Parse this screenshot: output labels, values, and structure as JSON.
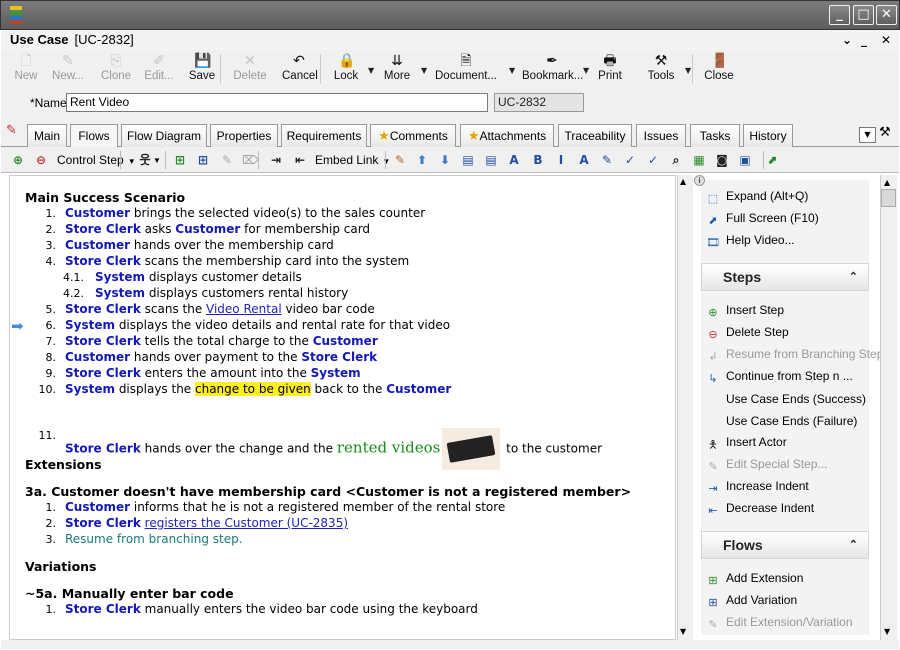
{
  "window": {
    "minimize": "_",
    "maximize": "□",
    "close": "✕"
  },
  "doc": {
    "type": "Use Case",
    "id_bracket": "[UC-2832]",
    "pin": "⌄",
    "close": "✕"
  },
  "toolbar": [
    {
      "label": "New",
      "icon": "new-document-icon",
      "glyph": "🗋",
      "enabled": false
    },
    {
      "label": "New...",
      "icon": "new-wizard-icon",
      "glyph": "✎",
      "enabled": false
    },
    {
      "label": "Clone",
      "icon": "clone-icon",
      "glyph": "⎘",
      "enabled": false
    },
    {
      "label": "Edit...",
      "icon": "edit-icon",
      "glyph": "✐",
      "enabled": false
    },
    {
      "label": "Save",
      "icon": "save-icon",
      "glyph": "💾",
      "enabled": true
    },
    {
      "label": "Delete",
      "icon": "delete-icon",
      "glyph": "✕",
      "enabled": false
    },
    {
      "label": "Cancel",
      "icon": "cancel-icon",
      "glyph": "↶",
      "enabled": true
    },
    {
      "label": "Lock",
      "icon": "lock-icon",
      "glyph": "🔒",
      "enabled": true
    },
    {
      "label": "More",
      "icon": "more-icon",
      "glyph": "⇊",
      "enabled": true
    },
    {
      "label": "Document...",
      "icon": "document-icon",
      "glyph": "🗎",
      "enabled": true
    },
    {
      "label": "Bookmark...",
      "icon": "bookmark-icon",
      "glyph": "✒",
      "enabled": true
    },
    {
      "label": "Print",
      "icon": "print-icon",
      "glyph": "🖶",
      "enabled": true
    },
    {
      "label": "Tools",
      "icon": "tools-icon",
      "glyph": "⚒",
      "enabled": true
    },
    {
      "label": "Close",
      "icon": "close-door-icon",
      "glyph": "🚪",
      "enabled": true
    }
  ],
  "name_field": {
    "label": "*Name:",
    "value": "Rent Video",
    "id_value": "UC-2832"
  },
  "tabs": [
    "Main",
    "Flows",
    "Flow Diagram",
    "Properties",
    "Requirements",
    "Comments",
    "Attachments",
    "Traceability",
    "Issues",
    "Tasks",
    "History"
  ],
  "active_tab": "Flows",
  "toolbar2": {
    "control_step": "Control Step",
    "embed_link": "Embed Link"
  },
  "scenario": {
    "main_heading": "Main Success Scenario",
    "steps": [
      {
        "n": "1.",
        "parts": [
          [
            "a",
            "Customer"
          ],
          [
            "t",
            " brings the selected video(s) to the sales counter"
          ]
        ]
      },
      {
        "n": "2.",
        "parts": [
          [
            "a",
            "Store Clerk"
          ],
          [
            "t",
            " asks "
          ],
          [
            "a",
            "Customer"
          ],
          [
            "t",
            " for membership card"
          ]
        ]
      },
      {
        "n": "3.",
        "parts": [
          [
            "a",
            "Customer"
          ],
          [
            "t",
            " hands over the membership card"
          ]
        ]
      },
      {
        "n": "4.",
        "parts": [
          [
            "a",
            "Store Clerk"
          ],
          [
            "t",
            " scans the membership card into the system"
          ]
        ]
      },
      {
        "n": "4.1.",
        "sub": true,
        "parts": [
          [
            "a",
            "System"
          ],
          [
            "t",
            " displays customer details"
          ]
        ]
      },
      {
        "n": "4.2.",
        "sub": true,
        "parts": [
          [
            "a",
            "System"
          ],
          [
            "t",
            " displays customers rental history"
          ]
        ]
      },
      {
        "n": "5.",
        "parts": [
          [
            "a",
            "Store Clerk"
          ],
          [
            "t",
            " scans the "
          ],
          [
            "l",
            "Video Rental"
          ],
          [
            "t",
            " video bar code"
          ]
        ]
      },
      {
        "n": "6.",
        "parts": [
          [
            "a",
            "System"
          ],
          [
            "t",
            " displays the video details and rental rate for that video"
          ]
        ]
      },
      {
        "n": "7.",
        "parts": [
          [
            "a",
            "Store Clerk"
          ],
          [
            "t",
            " tells the total charge to the "
          ],
          [
            "a",
            "Customer"
          ]
        ]
      },
      {
        "n": "8.",
        "parts": [
          [
            "a",
            "Customer"
          ],
          [
            "t",
            " hands over payment to the "
          ],
          [
            "a",
            "Store Clerk"
          ]
        ]
      },
      {
        "n": "9.",
        "parts": [
          [
            "a",
            "Store Clerk"
          ],
          [
            "t",
            " enters the amount into the "
          ],
          [
            "a",
            "System"
          ]
        ]
      },
      {
        "n": "10.",
        "parts": [
          [
            "a",
            "System"
          ],
          [
            "t",
            " displays the "
          ],
          [
            "h",
            "change to be given"
          ],
          [
            "t",
            " back to the "
          ],
          [
            "a",
            "Customer"
          ]
        ]
      },
      {
        "n": "11.",
        "parts": [
          [
            "a",
            "Store Clerk"
          ],
          [
            "t",
            " hands over the change and the "
          ],
          [
            "g",
            "rented videos"
          ],
          [
            "img",
            ""
          ],
          [
            "t",
            " to the customer"
          ]
        ]
      }
    ],
    "ext_heading": "Extensions",
    "ext_title": "3a. Customer doesn't have membership card <Customer is not a registered member>",
    "ext_steps": [
      {
        "n": "1.",
        "parts": [
          [
            "a",
            "Customer"
          ],
          [
            "t",
            " informs that he is not a registered member of the rental store"
          ]
        ]
      },
      {
        "n": "2.",
        "parts": [
          [
            "a",
            "Store Clerk"
          ],
          [
            "t",
            " "
          ],
          [
            "l",
            "registers the Customer (UC-2835)"
          ]
        ]
      },
      {
        "n": "3.",
        "parts": [
          [
            "c",
            "Resume from branching step."
          ]
        ]
      }
    ],
    "var_heading": "Variations",
    "var_title": "~5a. Manually enter bar code",
    "var_steps": [
      {
        "n": "1.",
        "parts": [
          [
            "a",
            "Store Clerk"
          ],
          [
            "t",
            " manually enters the video bar code using the keyboard"
          ]
        ]
      }
    ]
  },
  "panel": {
    "top_items": [
      {
        "label": "Expand (Alt+Q)",
        "icon": "expand-icon",
        "glyph": "⬚"
      },
      {
        "label": "Full Screen (F10)",
        "icon": "fullscreen-icon",
        "glyph": "⬈"
      },
      {
        "label": "Help Video...",
        "icon": "help-video-icon",
        "glyph": "🎞"
      }
    ],
    "steps_heading": "Steps",
    "steps_items": [
      {
        "label": "Insert Step",
        "icon": "insert-step-icon",
        "glyph": "⊕",
        "enabled": true
      },
      {
        "label": "Delete Step",
        "icon": "delete-step-icon",
        "glyph": "⊖",
        "enabled": true
      },
      {
        "label": "Resume from Branching Step",
        "icon": "resume-icon",
        "glyph": "↲",
        "enabled": false
      },
      {
        "label": "Continue from Step n ...",
        "icon": "continue-icon",
        "glyph": "↳",
        "enabled": true
      },
      {
        "label": "Use Case Ends (Success)",
        "icon": "",
        "glyph": "",
        "enabled": true
      },
      {
        "label": "Use Case Ends (Failure)",
        "icon": "",
        "glyph": "",
        "enabled": true
      },
      {
        "label": "Insert Actor",
        "icon": "actor-icon",
        "glyph": "🯅",
        "enabled": true
      },
      {
        "label": "Edit Special Step...",
        "icon": "edit-special-icon",
        "glyph": "✎",
        "enabled": false
      },
      {
        "label": "Increase Indent",
        "icon": "increase-indent-icon",
        "glyph": "⇥",
        "enabled": true
      },
      {
        "label": "Decrease Indent",
        "icon": "decrease-indent-icon",
        "glyph": "⇤",
        "enabled": true
      }
    ],
    "flows_heading": "Flows",
    "flows_items": [
      {
        "label": "Add Extension",
        "icon": "add-extension-icon",
        "glyph": "⊞",
        "enabled": true
      },
      {
        "label": "Add Variation",
        "icon": "add-variation-icon",
        "glyph": "⊞",
        "enabled": true
      },
      {
        "label": "Edit Extension/Variation",
        "icon": "edit-extension-icon",
        "glyph": "✎",
        "enabled": false
      }
    ],
    "collapse": "⌃"
  },
  "colors": {
    "actor": "#1518b8",
    "highlight": "#ffee22",
    "green": "#1a8a1a"
  }
}
